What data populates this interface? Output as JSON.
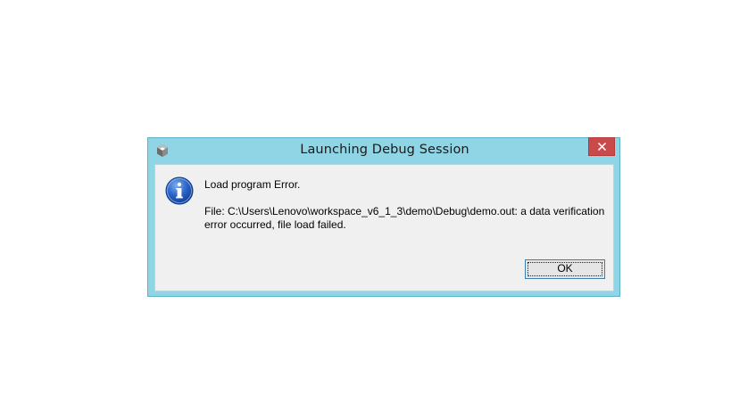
{
  "window": {
    "title": "Launching Debug Session",
    "app_icon": "eclipse-app-icon",
    "close_icon": "close-icon",
    "frame_color": "#8fd5e6",
    "close_color": "#c94a4a"
  },
  "message": {
    "icon": "info-icon",
    "heading": "Load program Error.",
    "body": "File: C:\\Users\\Lenovo\\workspace_v6_1_3\\demo\\Debug\\demo.out: a data verification error occurred, file load failed."
  },
  "buttons": {
    "ok_label": "OK"
  }
}
